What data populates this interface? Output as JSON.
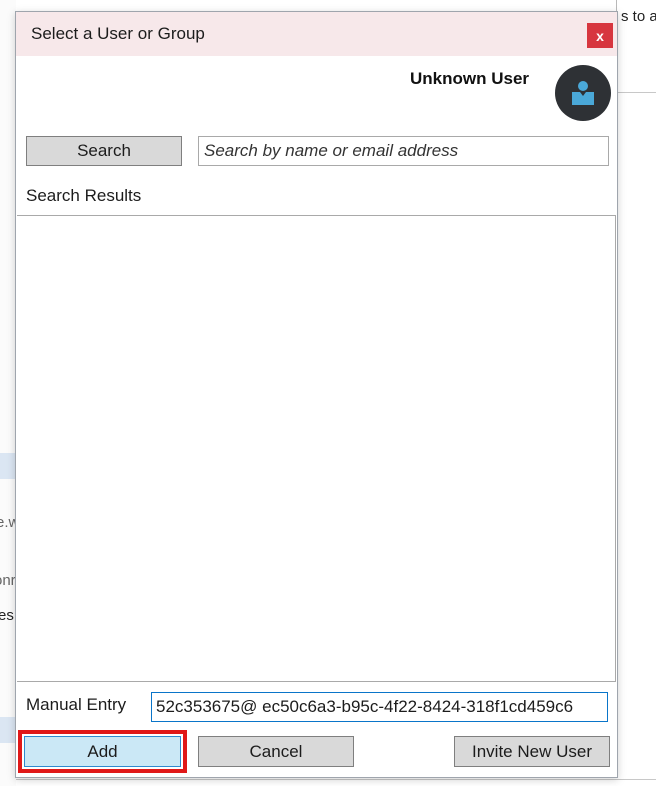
{
  "background": {
    "top_right_text": "s to a",
    "left_fragments": [
      "e.w",
      "onr",
      "es"
    ]
  },
  "dialog": {
    "title": "Select a User or Group",
    "close_label": "x",
    "user_name": "Unknown User",
    "avatar_icon": "user-badge-icon",
    "search_button": "Search",
    "search_placeholder": "Search by name or email address",
    "search_value": "",
    "results_label": "Search Results",
    "results": [],
    "manual_entry_label": "Manual Entry",
    "manual_entry_value": "52c353675@ ec50c6a3-b95c-4f22-8424-318f1cd459c6",
    "add_button": "Add",
    "cancel_button": "Cancel",
    "invite_button": "Invite New User"
  },
  "colors": {
    "title_bar": "#f7e8ea",
    "close_button": "#d7363f",
    "add_button": "#cbe8f6",
    "highlight_box": "#e01818",
    "avatar_bg": "#2e3135",
    "avatar_icon": "#4aa8d8"
  }
}
